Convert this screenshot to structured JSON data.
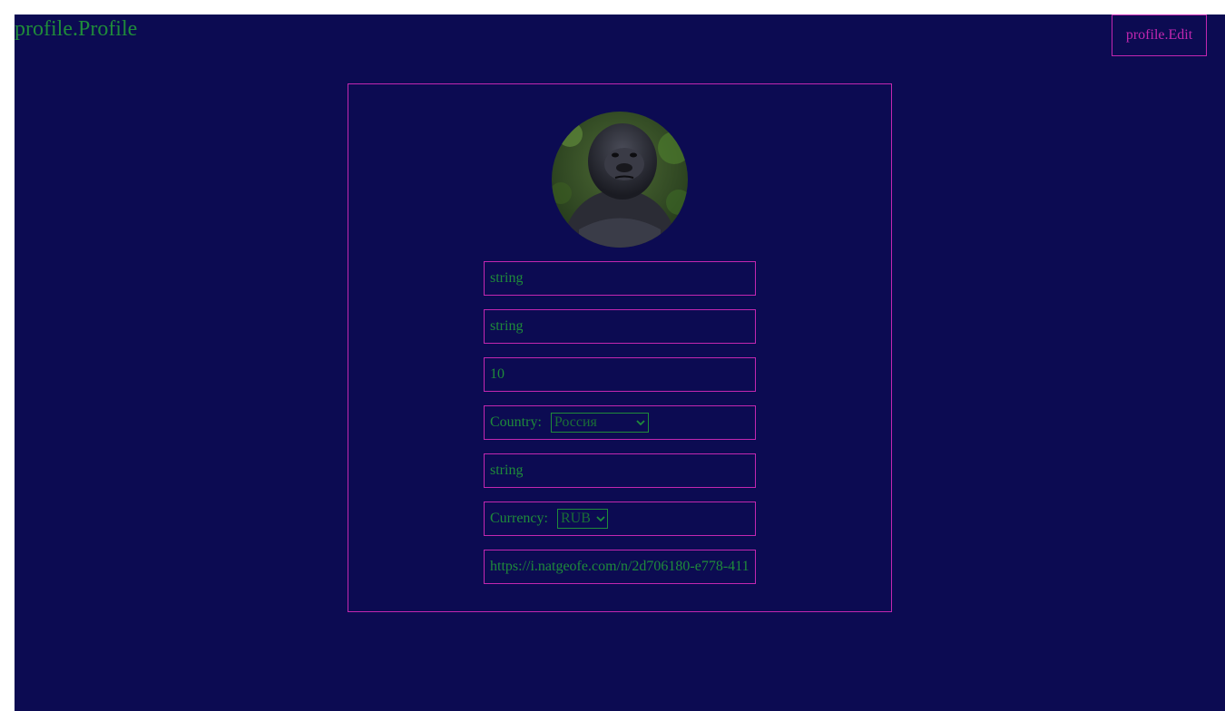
{
  "header": {
    "title": "profile.Profile",
    "edit_label": "profile.Edit"
  },
  "profile": {
    "first_name": "string",
    "last_name": "string",
    "age": "10",
    "country_label": "Country:",
    "country_value": "Россия",
    "city": "string",
    "currency_label": "Currency:",
    "currency_value": "RUB",
    "avatar_url": "https://i.natgeofe.com/n/2d706180-e778-411"
  },
  "icons": {
    "dropdown": "chevron-down-icon"
  },
  "colors": {
    "background": "#0c0b52",
    "accent_border": "#c227b0",
    "text": "#1f8b3a"
  }
}
